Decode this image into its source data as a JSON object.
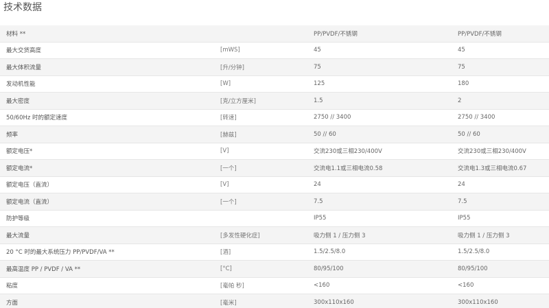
{
  "section": {
    "title": "技术数据"
  },
  "rows": [
    {
      "label": "材料 **",
      "unit": "",
      "v1": "PP/PVDF/不锈钢",
      "v2": "PP/PVDF/不锈钢"
    },
    {
      "label": "最大交货高度",
      "unit": "[mWS]",
      "v1": "45",
      "v2": "45"
    },
    {
      "label": "最大体积流量",
      "unit": "[升/分钟]",
      "v1": "75",
      "v2": "75"
    },
    {
      "label": "发动机性能",
      "unit": "[W]",
      "v1": "125",
      "v2": "180"
    },
    {
      "label": "最大密度",
      "unit": "[克/立方厘米]",
      "v1": "1.5",
      "v2": "2"
    },
    {
      "label": "50/60Hz 时的额定速度",
      "unit": "[转速]",
      "v1": "2750 // 3400",
      "v2": "2750 // 3400"
    },
    {
      "label": "频率",
      "unit": "[赫兹]",
      "v1": "50 // 60",
      "v2": "50 // 60"
    },
    {
      "label": "额定电压*",
      "unit": "[V]",
      "v1": "交流230或三相230/400V",
      "v2": "交流230或三相230/400V"
    },
    {
      "label": "额定电流*",
      "unit": "[一个]",
      "v1": "交流电1.1或三相电流0.58",
      "v2": "交流电1.3或三相电流0.67"
    },
    {
      "label": "额定电压（直流）",
      "unit": "[V]",
      "v1": "24",
      "v2": "24"
    },
    {
      "label": "额定电流（直流）",
      "unit": "[一个]",
      "v1": "7.5",
      "v2": "7.5"
    },
    {
      "label": "防护等级",
      "unit": "",
      "v1": "IP55",
      "v2": "IP55"
    },
    {
      "label": "最大流量",
      "unit": "[多发性硬化症]",
      "v1": "吸力侧 1 / 压力侧 3",
      "v2": "吸力侧 1 / 压力侧 3"
    },
    {
      "label": "20 °C 时的最大系统压力 PP/PVDF/VA **",
      "unit": "[酒]",
      "v1": "1.5/2.5/8.0",
      "v2": "1.5/2.5/8.0"
    },
    {
      "label": "最高温度 PP / PVDF / VA **",
      "unit": "[°C]",
      "v1": "80/95/100",
      "v2": "80/95/100"
    },
    {
      "label": "粘度",
      "unit": "[毫帕 秒]",
      "v1": "<160",
      "v2": "<160"
    },
    {
      "label": "方面",
      "unit": "[毫米]",
      "v1": "300x110x160",
      "v2": "300x110x160"
    }
  ]
}
